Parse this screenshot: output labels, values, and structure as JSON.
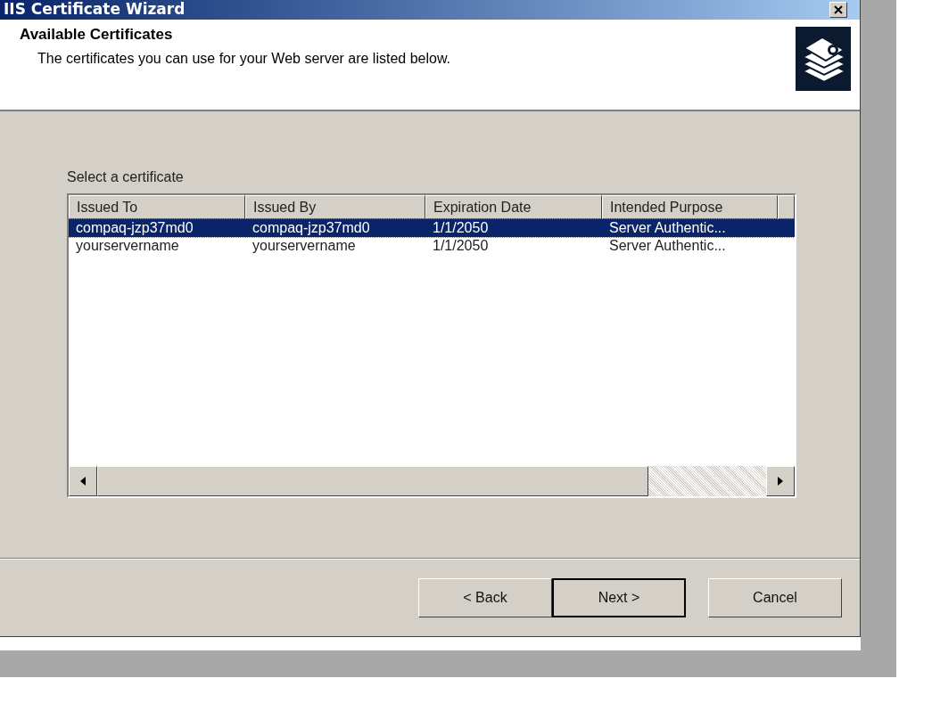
{
  "window": {
    "title": "IIS Certificate Wizard"
  },
  "header": {
    "title": "Available Certificates",
    "subtitle": "The certificates you can use for your Web server are listed below."
  },
  "list": {
    "label": "Select a certificate",
    "columns": [
      "Issued To",
      "Issued By",
      "Expiration Date",
      "Intended Purpose"
    ],
    "rows": [
      {
        "cells": [
          "compaq-jzp37md0",
          "compaq-jzp37md0",
          "1/1/2050",
          "Server Authentic..."
        ],
        "selected": true
      },
      {
        "cells": [
          "yourservername",
          "yourservername",
          "1/1/2050",
          "Server Authentic..."
        ],
        "selected": false
      }
    ]
  },
  "buttons": [
    {
      "label": "< Back",
      "default": false
    },
    {
      "label": "Next >",
      "default": true
    },
    {
      "label": "Cancel",
      "default": false
    }
  ]
}
